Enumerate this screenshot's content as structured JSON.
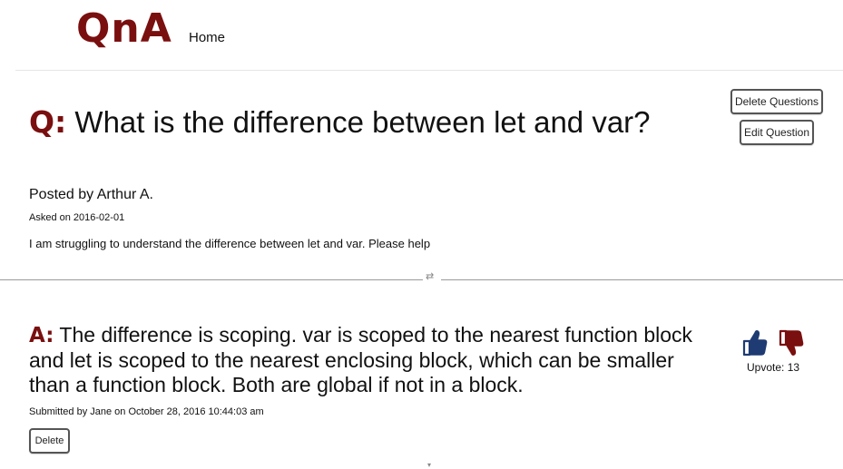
{
  "nav": {
    "logo": "QnA",
    "home_label": "Home"
  },
  "question": {
    "marker": "Q:",
    "title": "What is the difference between let and var?",
    "posted_by": "Posted by Arthur A.",
    "asked_on": "Asked on 2016-02-01",
    "body": "I am struggling to understand the difference between let and var. Please help",
    "delete_label": "Delete Questions",
    "edit_label": "Edit Question"
  },
  "divider_glyph": "⇄",
  "answer": {
    "marker": "A:",
    "text": "The difference is scoping. var is scoped to the nearest function block and let is scoped to the nearest enclosing block, which can be smaller than a function block. Both are global if not in a block.",
    "meta": "Submitted by Jane on October 28, 2016 10:44:03 am",
    "delete_label": "Delete",
    "upvote_text": "Upvote: 13"
  },
  "colors": {
    "brand": "#7a0f0f",
    "thumb_up": "#1f3b73",
    "thumb_down": "#7a0f0f"
  },
  "icons": {
    "upvote": "thumbs-up-icon",
    "downvote": "thumbs-down-icon"
  }
}
